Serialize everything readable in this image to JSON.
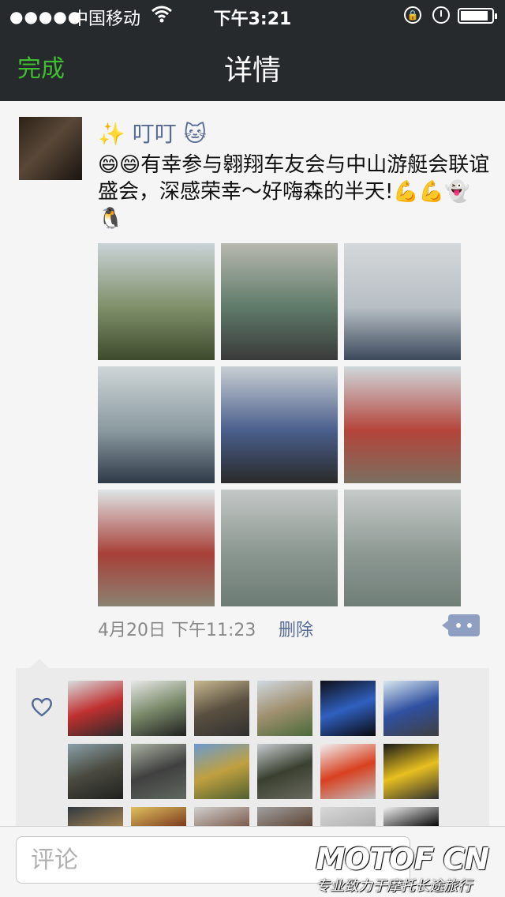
{
  "status_bar": {
    "signal": "●●●●●",
    "carrier": "中国移动",
    "time": "下午3:21"
  },
  "nav": {
    "done_label": "完成",
    "title": "详情"
  },
  "post": {
    "author": "✨ 叮叮 🐱",
    "text": "😄😄有幸参与翱翔车友会与中山游艇会联谊盛会，深感荣幸～好嗨森的半天!💪💪👻🐧",
    "timestamp": "4月20日 下午11:23",
    "delete_label": "删除",
    "photos": [
      {
        "name": "group-photo",
        "colors": [
          "#c9d3d6",
          "#7f8f6a",
          "#3e4a2c"
        ]
      },
      {
        "name": "motorcycle-photo",
        "colors": [
          "#b8b8b0",
          "#5f7a6a",
          "#3a3a3a"
        ]
      },
      {
        "name": "bridge-boat-photo",
        "colors": [
          "#d5d8da",
          "#b7bec4",
          "#3c4a5c"
        ]
      },
      {
        "name": "jetski-photo",
        "colors": [
          "#cfd6d8",
          "#8a9aa0",
          "#2f3a48"
        ]
      },
      {
        "name": "lifejacket-photo",
        "colors": [
          "#c9cfd3",
          "#4a5f8c",
          "#2a2a2a"
        ]
      },
      {
        "name": "red-motorcycle-photo",
        "colors": [
          "#cfd8dc",
          "#b4443a",
          "#7a7060"
        ]
      },
      {
        "name": "rider-photo",
        "colors": [
          "#dfe4e6",
          "#a84038",
          "#8a8272"
        ]
      },
      {
        "name": "river-photo-1",
        "colors": [
          "#c4c8c6",
          "#8a9690",
          "#6e7c76"
        ]
      },
      {
        "name": "river-photo-2",
        "colors": [
          "#c6cac8",
          "#8d9893",
          "#707e78"
        ]
      }
    ]
  },
  "likes": {
    "avatars": [
      {
        "name": "liker-avatar-1",
        "colors": [
          "#d8dde0",
          "#c03030",
          "#2a2a2a"
        ]
      },
      {
        "name": "liker-avatar-2",
        "colors": [
          "#e8e8e8",
          "#7a8a6a",
          "#202020"
        ]
      },
      {
        "name": "liker-avatar-3",
        "colors": [
          "#c8b890",
          "#5a5040",
          "#303030"
        ]
      },
      {
        "name": "liker-avatar-4",
        "colors": [
          "#d0d8e0",
          "#a09070",
          "#4a6a3a"
        ]
      },
      {
        "name": "liker-avatar-5",
        "colors": [
          "#101018",
          "#3060c0",
          "#0a0a10"
        ]
      },
      {
        "name": "liker-avatar-6",
        "colors": [
          "#d8e8f0",
          "#3050a0",
          "#404040"
        ]
      },
      {
        "name": "liker-avatar-7",
        "colors": [
          "#8aa0a8",
          "#4a4a40",
          "#202020"
        ]
      },
      {
        "name": "liker-avatar-8",
        "colors": [
          "#a8b0a0",
          "#404040",
          "#606860"
        ]
      },
      {
        "name": "liker-avatar-9",
        "colors": [
          "#6a9ad0",
          "#c0a040",
          "#506030"
        ]
      },
      {
        "name": "liker-avatar-10",
        "colors": [
          "#c8ccd0",
          "#3a4030",
          "#6a6a60"
        ]
      },
      {
        "name": "liker-avatar-11",
        "colors": [
          "#f0f0f0",
          "#d84020",
          "#c0c0c0"
        ]
      },
      {
        "name": "liker-avatar-12",
        "colors": [
          "#181818",
          "#e8c020",
          "#303030"
        ]
      },
      {
        "name": "liker-avatar-13",
        "colors": [
          "#303840",
          "#a08050",
          "#202020"
        ]
      },
      {
        "name": "liker-avatar-14",
        "colors": [
          "#e0c060",
          "#804020",
          "#403020"
        ]
      },
      {
        "name": "liker-avatar-15",
        "colors": [
          "#d0d0d0",
          "#806050",
          "#504040"
        ]
      },
      {
        "name": "liker-avatar-16",
        "colors": [
          "#a0a0a0",
          "#604838",
          "#404040"
        ]
      },
      {
        "name": "liker-avatar-17",
        "colors": [
          "#d8d8d8",
          "#b0b0b0",
          "#707070"
        ]
      },
      {
        "name": "liker-avatar-18",
        "colors": [
          "#f0f0f0",
          "#101010",
          "#202020"
        ]
      }
    ]
  },
  "comment_box": {
    "placeholder": "评论"
  },
  "watermark": {
    "brand": "MOTOF CN",
    "slogan": "专业致力于摩托长途旅行"
  },
  "colors": {
    "nav_bg": "#262a2d",
    "accent_green": "#3fbf2f",
    "link_blue": "#576b95"
  }
}
